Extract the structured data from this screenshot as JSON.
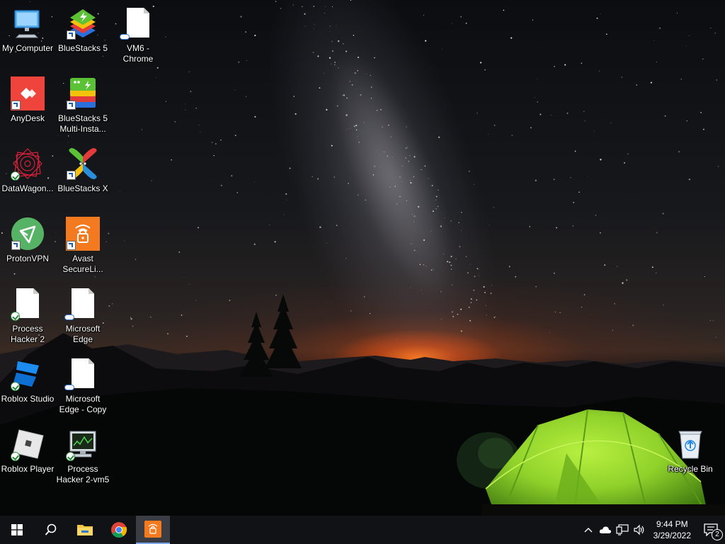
{
  "desktop": {
    "icons": [
      {
        "id": "my-computer",
        "label": "My Computer",
        "overlay": "none"
      },
      {
        "id": "bluestacks5",
        "label": "BlueStacks 5",
        "overlay": "shortcut"
      },
      {
        "id": "vm6-chrome",
        "label": "VM6 - Chrome",
        "overlay": "cloud"
      },
      {
        "id": "anydesk",
        "label": "AnyDesk",
        "overlay": "shortcut"
      },
      {
        "id": "bluestacks5-multi",
        "label": "BlueStacks 5 Multi-Insta...",
        "overlay": "shortcut"
      },
      {
        "id": "datawagon",
        "label": "DataWagon...",
        "overlay": "check"
      },
      {
        "id": "bluestacks-x",
        "label": "BlueStacks X",
        "overlay": "shortcut"
      },
      {
        "id": "protonvpn",
        "label": "ProtonVPN",
        "overlay": "shortcut"
      },
      {
        "id": "avast-secureline",
        "label": "Avast SecureLi...",
        "overlay": "shortcut"
      },
      {
        "id": "process-hacker-2",
        "label": "Process Hacker 2",
        "overlay": "check"
      },
      {
        "id": "microsoft-edge",
        "label": "Microsoft Edge",
        "overlay": "cloud"
      },
      {
        "id": "roblox-studio",
        "label": "Roblox Studio",
        "overlay": "check"
      },
      {
        "id": "microsoft-edge-copy",
        "label": "Microsoft Edge - Copy",
        "overlay": "cloud"
      },
      {
        "id": "roblox-player",
        "label": "Roblox Player",
        "overlay": "check"
      },
      {
        "id": "process-hacker-2-vm5",
        "label": "Process Hacker 2-vm5",
        "overlay": "check"
      },
      {
        "id": "recycle-bin",
        "label": "Recycle Bin",
        "overlay": "none"
      }
    ]
  },
  "taskbar": {
    "buttons": [
      {
        "id": "start",
        "icon": "windows-logo-icon"
      },
      {
        "id": "search",
        "icon": "search-icon"
      },
      {
        "id": "file-explorer",
        "icon": "folder-icon"
      },
      {
        "id": "chrome",
        "icon": "chrome-icon"
      },
      {
        "id": "avast",
        "icon": "avast-secureline-icon",
        "active": true
      }
    ],
    "tray": {
      "icons": [
        "chevron-up-icon",
        "onedrive-cloud-icon",
        "network-icon",
        "volume-icon"
      ],
      "time": "9:44 PM",
      "date": "3/29/2022",
      "notification_count": "2"
    }
  },
  "colors": {
    "taskbar_bg": "#101216",
    "active_indicator": "#7aa7e8",
    "tent_green": "#8fd12a"
  }
}
